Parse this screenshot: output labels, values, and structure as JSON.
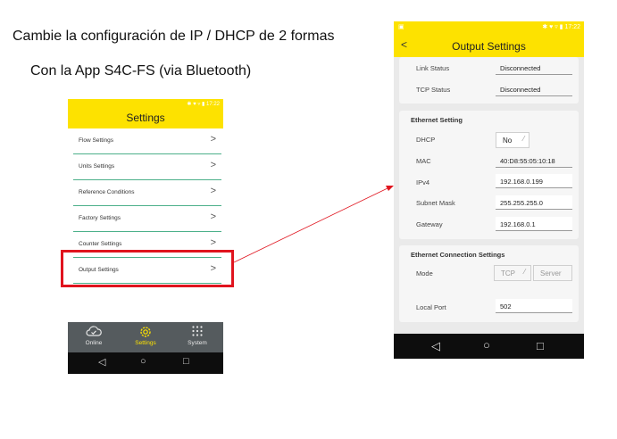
{
  "slide": {
    "title": "Cambie la configuración de IP / DHCP de 2 formas",
    "subtitle": "Con la App S4C-FS (via Bluetooth)"
  },
  "left_phone": {
    "status_time": "✱ ♥ ▿ ▮ 17:22",
    "title": "Settings",
    "items": [
      {
        "label": "Flow Settings",
        "chevron": ">"
      },
      {
        "label": "Units Settings",
        "chevron": ">"
      },
      {
        "label": "Reference Conditions",
        "chevron": ">"
      },
      {
        "label": "Factory Settings",
        "chevron": ">"
      },
      {
        "label": "Counter Settings",
        "chevron": ">"
      },
      {
        "label": "Output Settings",
        "chevron": ">"
      }
    ],
    "bottom_nav": [
      {
        "label": "Online",
        "icon": "cloud-check-icon",
        "active": false
      },
      {
        "label": "Settings",
        "icon": "gear-icon",
        "active": true
      },
      {
        "label": "System",
        "icon": "grid-icon",
        "active": false
      }
    ],
    "system_bar": {
      "back": "◁",
      "home": "○",
      "recent": "□"
    },
    "colors": {
      "header": "#fde200",
      "divider": "#4cb08a",
      "nav_bg": "#555b5e",
      "highlight": "#e0141e"
    }
  },
  "right_phone": {
    "status_left": "▣",
    "status_time": "✱ ♥ ▿ ▮ 17:22",
    "back": "<",
    "title": "Output Settings",
    "link_card": {
      "link_status_label": "Link Status",
      "link_status_value": "Disconnected",
      "tcp_status_label": "TCP Status",
      "tcp_status_value": "Disconnected"
    },
    "ethernet": {
      "heading": "Ethernet Setting",
      "dhcp_label": "DHCP",
      "dhcp_value": "No",
      "dhcp_caret": "⁄",
      "mac_label": "MAC",
      "mac_value": "40:D8:55:05:10:18",
      "ipv4_label": "IPv4",
      "ipv4_value": "192.168.0.199",
      "subnet_label": "Subnet Mask",
      "subnet_value": "255.255.255.0",
      "gateway_label": "Gateway",
      "gateway_value": "192.168.0.1"
    },
    "connection": {
      "heading": "Ethernet Connection Settings",
      "mode_label": "Mode",
      "mode_protocol": "TCP",
      "mode_caret": "⁄",
      "mode_role": "Server",
      "local_port_label": "Local Port",
      "local_port_value": "502"
    },
    "system_bar": {
      "back": "◁",
      "home": "○",
      "recent": "□"
    }
  }
}
